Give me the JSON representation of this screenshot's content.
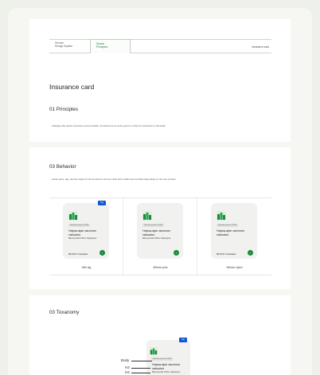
{
  "header": {
    "cell1": "Service\nDesign System",
    "cell2": "Sustus\nPrinciples",
    "cell3": "Insurance card"
  },
  "page_title": "Insurance card",
  "sections": {
    "principles": {
      "heading": "01 Principles",
      "paragraph": "• Displays the active insurance and its details. Functions as an entry point to a flow for insurance in full detail."
    },
    "behavior": {
      "heading": "03 Behavior",
      "paragraph": "• Away price, tag, and the object of the insurance can be made both visible and invisible depending on the use context."
    },
    "taxonomy": {
      "heading": "03 Toxanomy"
    }
  },
  "cards": [
    {
      "tag": "Tag",
      "chip": "Vakuutusnumero 12345",
      "title": "Hapsa-ajan asunnon vakuutus",
      "subtitle": "Baronpmäki 15H4, Rapanjoot",
      "price": "80,00 € / kuukausi",
      "caption": "With tag"
    },
    {
      "tag": "",
      "chip": "Vakuutusnumero 12345",
      "title": "Hapsa-ajan asunnon vakuutus",
      "subtitle": "Baronpmäki 15H4, Rapanjoot",
      "price": "",
      "caption": "Without price"
    },
    {
      "tag": "",
      "chip": "Vakuutusnumero 12345",
      "title": "Hapsa-ajan asunnon vakuutus",
      "subtitle": "",
      "price": "80,00 € / kuukausi",
      "caption": "Without object"
    }
  ],
  "taxonomy_card": {
    "tag": "Tag",
    "chip": "Vakuutusnumero 12345",
    "title": "Hapsa-ajan asunnon vakuutus",
    "subtitle": "Baronpmäki 15H4, Rapanjoot"
  },
  "taxonomy_labels": {
    "body": "Body",
    "h3": "H3",
    "h4": "H4"
  },
  "colors": {
    "accent": "#1b8a3b",
    "tag": "#1455d6"
  },
  "icons": {
    "card_icon": "green-building-icon",
    "go_icon": "arrow-right-icon"
  }
}
